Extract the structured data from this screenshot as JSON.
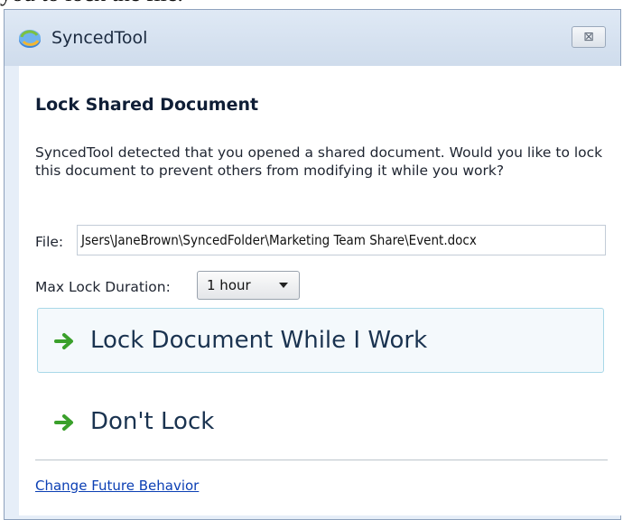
{
  "background": {
    "document_text": "you to lock the file."
  },
  "window": {
    "title": "SyncedTool",
    "close_glyph": "⊠",
    "icons": {
      "app": "sync-app-icon",
      "close": "close-icon",
      "command_arrow": "green-arrow-icon"
    },
    "colors": {
      "arrow_green": "#3aa02b",
      "link_blue": "#0b3fb4",
      "highlight_border": "#a9d8e8"
    }
  },
  "dialog": {
    "heading": "Lock Shared Document",
    "message": "SyncedTool detected that you opened a shared document. Would you like to lock this document to prevent others from modifying it while you work?",
    "file": {
      "label": "File:",
      "value": "Jsers\\JaneBrown\\SyncedFolder\\Marketing Team Share\\Event.docx"
    },
    "duration": {
      "label": "Max Lock Duration:",
      "selected": "1 hour"
    },
    "commands": [
      {
        "label": "Lock Document While I Work"
      },
      {
        "label": "Don't Lock"
      }
    ],
    "footer_link": "Change Future Behavior"
  }
}
